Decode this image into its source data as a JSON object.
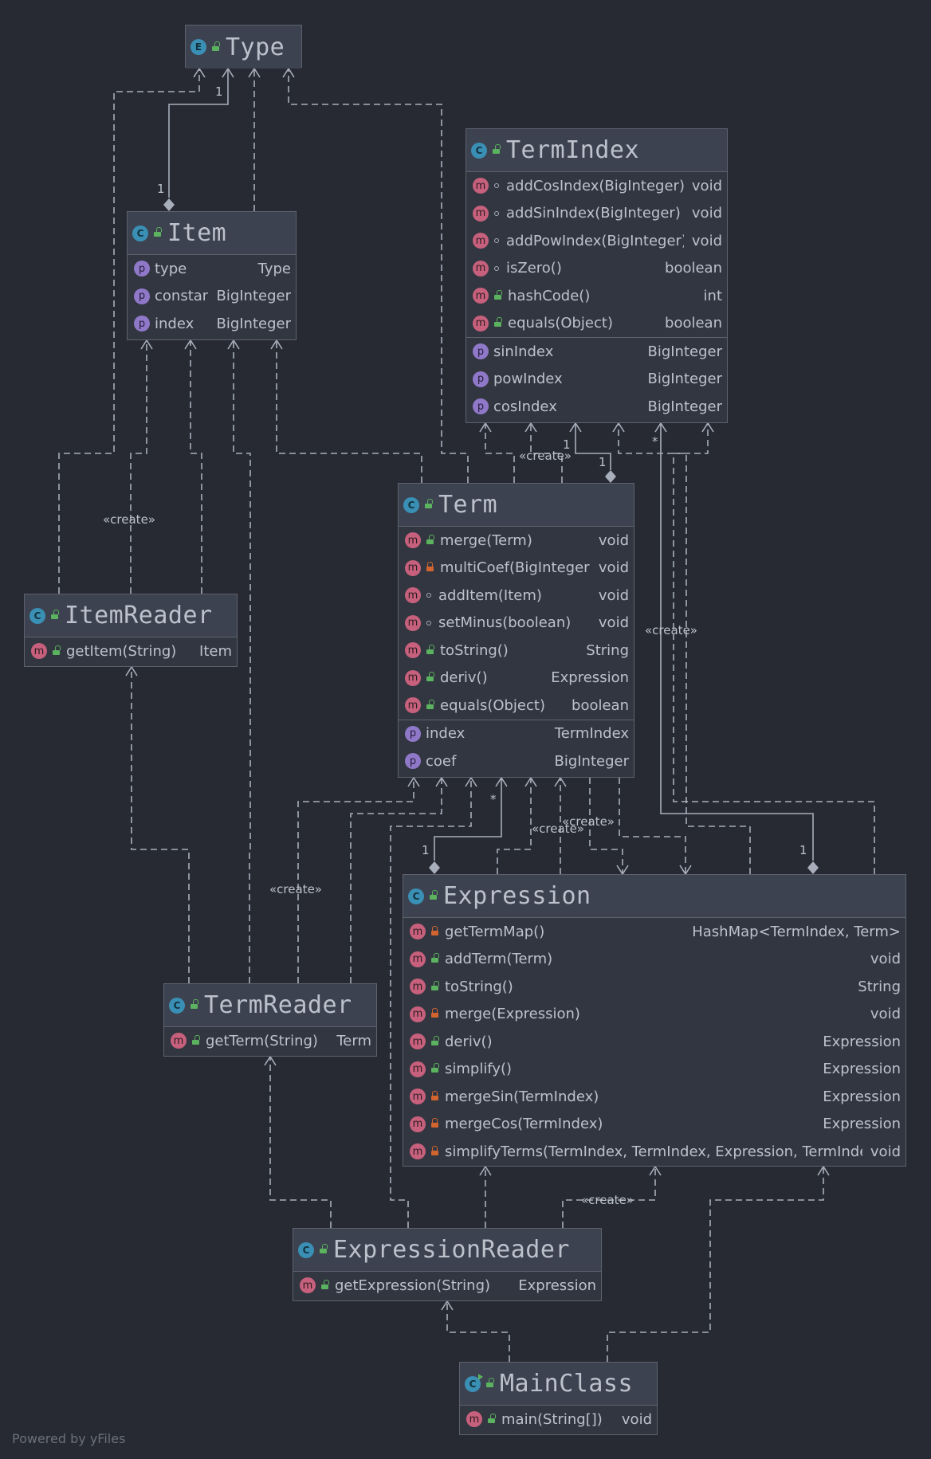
{
  "diagram": {
    "nodes": {
      "type": {
        "title": "Type",
        "icon": "enum-icon",
        "icon_letter": "E",
        "sections": []
      },
      "item": {
        "title": "Item",
        "icon": "class-icon",
        "icon_letter": "C",
        "sections": [
          [
            {
              "kind": "p",
              "access": "",
              "name": "type",
              "type": "Type"
            },
            {
              "kind": "p",
              "access": "",
              "name": "constant",
              "type": "BigInteger"
            },
            {
              "kind": "p",
              "access": "",
              "name": "index",
              "type": "BigInteger"
            }
          ]
        ]
      },
      "termindex": {
        "title": "TermIndex",
        "icon": "class-icon",
        "icon_letter": "C",
        "sections": [
          [
            {
              "kind": "m",
              "access": "package",
              "name": "addCosIndex(BigInteger)",
              "type": "void"
            },
            {
              "kind": "m",
              "access": "package",
              "name": "addSinIndex(BigInteger)",
              "type": "void"
            },
            {
              "kind": "m",
              "access": "package",
              "name": "addPowIndex(BigInteger)",
              "type": "void"
            },
            {
              "kind": "m",
              "access": "package",
              "name": "isZero()",
              "type": "boolean"
            },
            {
              "kind": "m",
              "access": "public",
              "name": "hashCode()",
              "type": "int"
            },
            {
              "kind": "m",
              "access": "public",
              "name": "equals(Object)",
              "type": "boolean"
            }
          ],
          [
            {
              "kind": "p",
              "access": "",
              "name": "sinIndex",
              "type": "BigInteger"
            },
            {
              "kind": "p",
              "access": "",
              "name": "powIndex",
              "type": "BigInteger"
            },
            {
              "kind": "p",
              "access": "",
              "name": "cosIndex",
              "type": "BigInteger"
            }
          ]
        ]
      },
      "term": {
        "title": "Term",
        "icon": "class-icon",
        "icon_letter": "C",
        "sections": [
          [
            {
              "kind": "m",
              "access": "public",
              "name": "merge(Term)",
              "type": "void"
            },
            {
              "kind": "m",
              "access": "private",
              "name": "multiCoef(BigInteger)",
              "type": "void"
            },
            {
              "kind": "m",
              "access": "package",
              "name": "addItem(Item)",
              "type": "void"
            },
            {
              "kind": "m",
              "access": "package",
              "name": "setMinus(boolean)",
              "type": "void"
            },
            {
              "kind": "m",
              "access": "public",
              "name": "toString()",
              "type": "String"
            },
            {
              "kind": "m",
              "access": "public",
              "name": "deriv()",
              "type": "Expression"
            },
            {
              "kind": "m",
              "access": "public",
              "name": "equals(Object)",
              "type": "boolean"
            }
          ],
          [
            {
              "kind": "p",
              "access": "",
              "name": "index",
              "type": "TermIndex"
            },
            {
              "kind": "p",
              "access": "",
              "name": "coef",
              "type": "BigInteger"
            }
          ]
        ]
      },
      "itemreader": {
        "title": "ItemReader",
        "icon": "class-icon",
        "icon_letter": "C",
        "sections": [
          [
            {
              "kind": "m",
              "access": "public",
              "name": "getItem(String)",
              "type": "Item"
            }
          ]
        ]
      },
      "expression": {
        "title": "Expression",
        "icon": "class-icon",
        "icon_letter": "C",
        "sections": [
          [
            {
              "kind": "m",
              "access": "private",
              "name": "getTermMap()",
              "type": "HashMap<TermIndex, Term>"
            },
            {
              "kind": "m",
              "access": "public",
              "name": "addTerm(Term)",
              "type": "void"
            },
            {
              "kind": "m",
              "access": "public",
              "name": "toString()",
              "type": "String"
            },
            {
              "kind": "m",
              "access": "private",
              "name": "merge(Expression)",
              "type": "void"
            },
            {
              "kind": "m",
              "access": "public",
              "name": "deriv()",
              "type": "Expression"
            },
            {
              "kind": "m",
              "access": "public",
              "name": "simplify()",
              "type": "Expression"
            },
            {
              "kind": "m",
              "access": "private",
              "name": "mergeSin(TermIndex)",
              "type": "Expression"
            },
            {
              "kind": "m",
              "access": "private",
              "name": "mergeCos(TermIndex)",
              "type": "Expression"
            },
            {
              "kind": "m",
              "access": "private",
              "name": "simplifyTerms(TermIndex, TermIndex, Expression, TermIndex)",
              "type": "void"
            }
          ]
        ]
      },
      "termreader": {
        "title": "TermReader",
        "icon": "class-icon",
        "icon_letter": "C",
        "sections": [
          [
            {
              "kind": "m",
              "access": "public",
              "name": "getTerm(String)",
              "type": "Term"
            }
          ]
        ]
      },
      "expressionreader": {
        "title": "ExpressionReader",
        "icon": "class-icon",
        "icon_letter": "C",
        "sections": [
          [
            {
              "kind": "m",
              "access": "public",
              "name": "getExpression(String)",
              "type": "Expression"
            }
          ]
        ]
      },
      "mainclass": {
        "title": "MainClass",
        "icon": "main-class-icon",
        "icon_letter": "C",
        "sections": [
          [
            {
              "kind": "m",
              "access": "public",
              "name": "main(String[])",
              "type": "void"
            }
          ]
        ]
      }
    },
    "labels": {
      "create": "«create»",
      "one": "1",
      "star": "*"
    },
    "footer": "Powered by yFiles",
    "colors": {
      "background": "#272a33",
      "node_fill": "#323640",
      "header_fill": "#3d4250",
      "border": "#5d626d",
      "edge": "#a8aebb",
      "method_badge": "#c6607c",
      "property_badge": "#8f78c8",
      "class_icon": "#3a8fb5",
      "public_lock": "#5bb25f",
      "private_lock": "#d2652f"
    }
  }
}
